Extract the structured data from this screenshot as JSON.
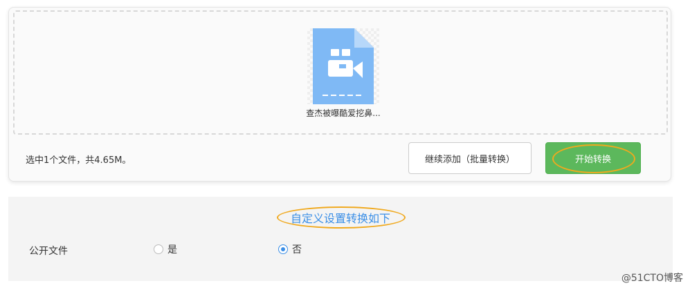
{
  "upload": {
    "file_name": "查杰被曝酷爱挖鼻...",
    "file_icon": "video-file-icon",
    "summary": "选中1个文件，共4.65M。",
    "add_button_label": "继续添加（批量转换）",
    "start_button_label": "开始转换"
  },
  "settings": {
    "title": "自定义设置转换如下",
    "public_file_label": "公开文件",
    "option_yes": "是",
    "option_no": "否",
    "selected": "否"
  },
  "watermark": "@51CTO博客",
  "colors": {
    "accent_blue": "#3a8ee6",
    "start_green": "#5cb85c",
    "highlight_orange": "#f0a91e",
    "file_icon_blue": "#7fb9f5"
  }
}
